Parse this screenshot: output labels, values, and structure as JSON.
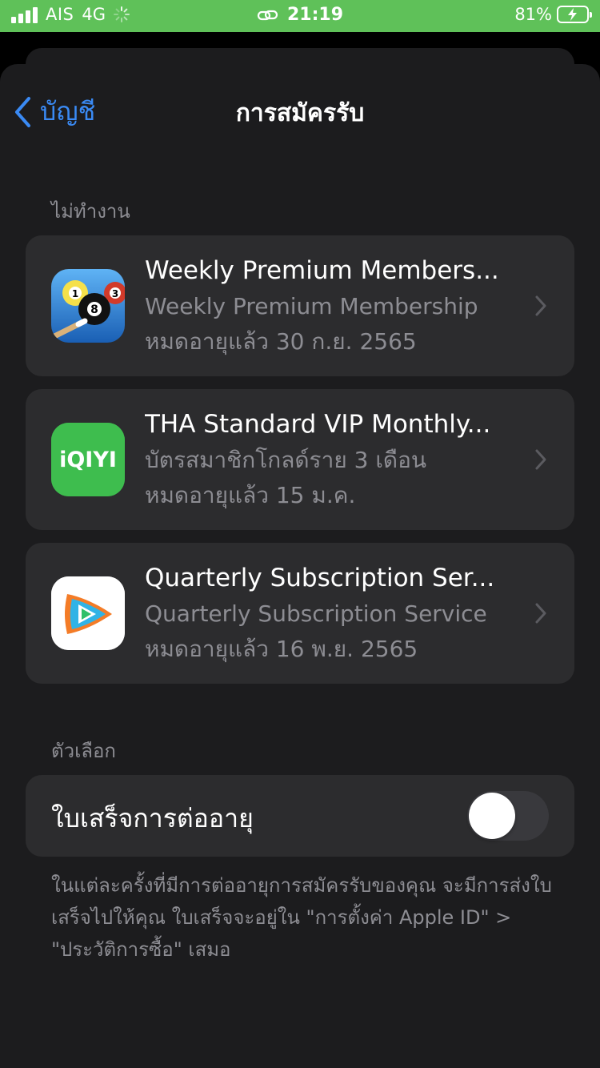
{
  "status_bar": {
    "carrier": "AIS",
    "network": "4G",
    "time": "21:19",
    "battery_percent": "81%",
    "icons": [
      "signal-icon",
      "loading-spinner-icon",
      "link-icon",
      "battery-charging-icon"
    ]
  },
  "nav": {
    "back_label": "บัญชี",
    "title": "การสมัครรับ"
  },
  "inactive_section": {
    "header": "ไม่ทำงาน",
    "items": [
      {
        "title": "Weekly Premium Members...",
        "subtitle": "Weekly Premium Membership",
        "expiry": "หมดอายุแล้ว 30 ก.ย. 2565",
        "icon": "eight-ball-pool-app-icon"
      },
      {
        "title": "THA Standard VIP Monthly...",
        "subtitle": "บัตรสมาชิกโกลด์ราย 3 เดือน",
        "expiry": "หมดอายุแล้ว 15 ม.ค.",
        "icon": "iqiyi-app-icon",
        "icon_text": "iQIYI"
      },
      {
        "title": "Quarterly Subscription Ser...",
        "subtitle": "Quarterly Subscription Service",
        "expiry": "หมดอายุแล้ว 16 พ.ย. 2565",
        "icon": "tencent-video-app-icon"
      }
    ]
  },
  "options_section": {
    "header": "ตัวเลือก",
    "renewal_receipts_label": "ใบเสร็จการต่ออายุ",
    "renewal_receipts_on": false,
    "footnote": "ในแต่ละครั้งที่มีการต่ออายุการสมัครรับของคุณ จะมีการส่งใบเสร็จไปให้คุณ ใบเสร็จจะอยู่ใน \"การตั้งค่า Apple ID\" > \"ประวัติการซื้อ\" เสมอ"
  },
  "colors": {
    "status_bar": "#5fc159",
    "background": "#1c1c1e",
    "card": "#2c2c2e",
    "accent": "#3a8af4",
    "secondary_text": "#8d8d93"
  }
}
